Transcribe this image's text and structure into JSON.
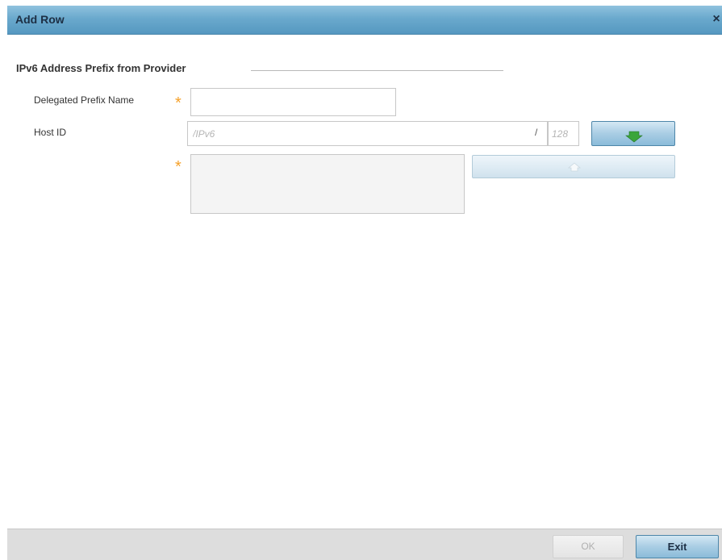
{
  "dialog": {
    "title": "Add Row",
    "close_glyph": "×"
  },
  "section": {
    "title": "IPv6 Address Prefix from Provider"
  },
  "form": {
    "delegated_prefix_name": {
      "label": "Delegated Prefix Name",
      "value": "",
      "required": true
    },
    "host_id": {
      "label": "Host ID",
      "ipv6_placeholder": "/IPv6",
      "slash": "/",
      "prefix_length_placeholder": "128",
      "add_button_icon": "arrow-down-icon",
      "list_required": true,
      "remove_button_icon": "arrow-up-icon"
    },
    "required_marker": "*"
  },
  "footer": {
    "ok_label": "OK",
    "exit_label": "Exit"
  },
  "colors": {
    "titlebar": "#6aa9cd",
    "required": "#f5a12b",
    "add_icon": "#3aa53a"
  }
}
